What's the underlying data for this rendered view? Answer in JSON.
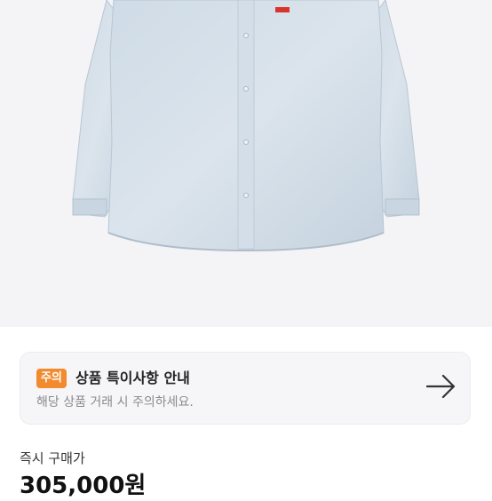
{
  "product_image": {
    "alt_subject": "shirt-image"
  },
  "notice": {
    "badge": "주의",
    "title": "상품 특이사항 안내",
    "subtitle": "해당 상품 거래 시 주의하세요.",
    "icon": "arrow-right-icon",
    "badge_color": "#f28a2e"
  },
  "price": {
    "label": "즉시 구매가",
    "value": "305,000원"
  }
}
